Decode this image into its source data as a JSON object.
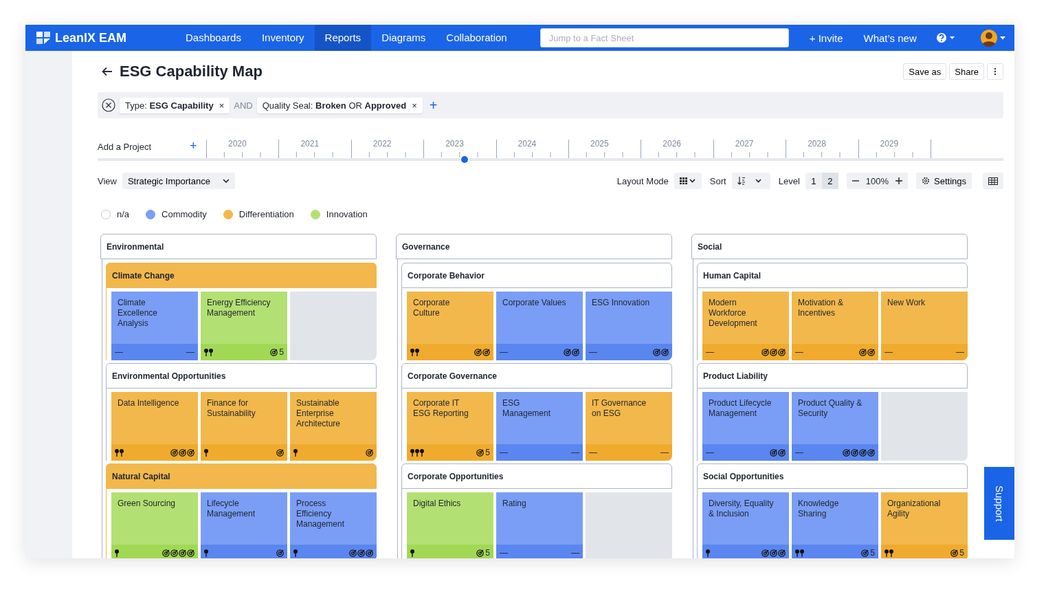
{
  "nav": {
    "logo": "LeanIX EAM",
    "items": [
      {
        "label": "Dashboards",
        "selected": false
      },
      {
        "label": "Inventory",
        "selected": false
      },
      {
        "label": "Reports",
        "selected": true
      },
      {
        "label": "Diagrams",
        "selected": false
      },
      {
        "label": "Collaboration",
        "selected": false
      }
    ],
    "search": {
      "placeholder": "Jump to a Fact Sheet"
    },
    "invite": "+ Invite",
    "whats_new": "What’s new"
  },
  "page": {
    "title": "ESG Capability Map",
    "actions": [
      "Save as",
      "Share"
    ]
  },
  "filters": {
    "chips": [
      {
        "text": "Type: **ESG Capability**",
        "remove": "×"
      },
      {
        "text": "Quality Seal: **Broken** OR **Approved**",
        "remove": "×"
      }
    ],
    "joiner": "AND",
    "add": "+"
  },
  "timeline": {
    "label": "Add a Project",
    "add": "+",
    "years": [
      "2020",
      "2021",
      "2022",
      "2023",
      "2024",
      "2025",
      "2026",
      "2027",
      "2028",
      "2029"
    ],
    "level": 0.405
  },
  "toolbar": {
    "view_label": "View",
    "view_value": "Strategic Importance",
    "layout_label": "Layout Mode",
    "sort_label": "Sort",
    "level_label": "Level",
    "levels": [
      {
        "label": "1",
        "selected": false
      },
      {
        "label": "2",
        "selected": true
      }
    ],
    "zoom": "100%",
    "settings": "Settings"
  },
  "legend": [
    {
      "label": "n/a",
      "kind": "none"
    },
    {
      "label": "Commodity",
      "kind": "commodity",
      "color": "#7b9ef6"
    },
    {
      "label": "Differentiation",
      "kind": "differentiation",
      "color": "#f2b84b"
    },
    {
      "label": "Innovation",
      "kind": "innovation",
      "color": "#b3e072"
    }
  ],
  "groups": [
    {
      "title": "Environmental",
      "children": [
        {
          "title": "Climate Change",
          "kind": "differentiation",
          "cards": [
            {
              "name": "Climate Excellence Analysis",
              "kind": "commodity",
              "left": {
                "text": "—"
              },
              "right": {
                "text": "—"
              }
            },
            {
              "name": "Energy Efficiency Management",
              "kind": "innovation",
              "left": {
                "icons": [
                  {
                    "kind": "pin"
                  },
                  {
                    "kind": "pin"
                  }
                ]
              },
              "right": {
                "icons": [
                  {
                    "kind": "target"
                  }
                ],
                "text": "5"
              }
            },
            {
              "kind": "empty"
            }
          ]
        },
        {
          "title": "Environmental Opportunities",
          "kind": "none",
          "cards": [
            {
              "name": "Data Intelligence",
              "kind": "differentiation",
              "left": {
                "icons": [
                  {
                    "kind": "pin"
                  },
                  {
                    "kind": "pin"
                  }
                ]
              },
              "right": {
                "icons": [
                  {
                    "kind": "target"
                  },
                  {
                    "kind": "target"
                  },
                  {
                    "kind": "target"
                  }
                ]
              }
            },
            {
              "name": "Finance for Sustainability",
              "kind": "differentiation",
              "left": {
                "icons": [
                  {
                    "kind": "pin"
                  }
                ]
              },
              "right": {
                "icons": [
                  {
                    "kind": "target"
                  }
                ]
              }
            },
            {
              "name": "Sustainable Enterprise Architecture",
              "kind": "differentiation",
              "left": {
                "icons": [
                  {
                    "kind": "pin"
                  }
                ]
              },
              "right": {
                "icons": [
                  {
                    "kind": "target"
                  }
                ]
              }
            }
          ]
        },
        {
          "title": "Natural Capital",
          "kind": "differentiation",
          "cards": [
            {
              "name": "Green Sourcing",
              "kind": "innovation",
              "left": {
                "icons": [
                  {
                    "kind": "pin"
                  }
                ]
              },
              "right": {
                "icons": [
                  {
                    "kind": "target"
                  },
                  {
                    "kind": "target"
                  },
                  {
                    "kind": "target"
                  },
                  {
                    "kind": "target"
                  }
                ]
              }
            },
            {
              "name": "Lifecycle Management",
              "kind": "commodity",
              "left": {
                "icons": [
                  {
                    "kind": "pin"
                  }
                ]
              },
              "right": {
                "icons": [
                  {
                    "kind": "target"
                  }
                ]
              }
            },
            {
              "name": "Process Efficiency Management",
              "kind": "commodity",
              "left": {
                "icons": [
                  {
                    "kind": "pin"
                  }
                ]
              },
              "right": {
                "icons": [
                  {
                    "kind": "target"
                  },
                  {
                    "kind": "target"
                  },
                  {
                    "kind": "target"
                  }
                ]
              }
            }
          ]
        }
      ]
    },
    {
      "title": "Governance",
      "children": [
        {
          "title": "Corporate Behavior",
          "kind": "none",
          "cards": [
            {
              "name": "Corporate Culture",
              "kind": "differentiation",
              "left": {
                "icons": [
                  {
                    "kind": "pin"
                  },
                  {
                    "kind": "pin"
                  }
                ]
              },
              "right": {
                "icons": [
                  {
                    "kind": "target"
                  },
                  {
                    "kind": "target"
                  }
                ]
              }
            },
            {
              "name": "Corporate Values",
              "kind": "commodity",
              "left": {
                "text": "—"
              },
              "right": {
                "icons": [
                  {
                    "kind": "target"
                  },
                  {
                    "kind": "target"
                  }
                ]
              }
            },
            {
              "name": "ESG Innovation",
              "kind": "commodity",
              "left": {
                "text": "—"
              },
              "right": {
                "icons": [
                  {
                    "kind": "target"
                  },
                  {
                    "kind": "target"
                  }
                ]
              }
            }
          ]
        },
        {
          "title": "Corporate Governance",
          "kind": "none",
          "cards": [
            {
              "name": "Corporate IT ESG Reporting",
              "kind": "differentiation",
              "left": {
                "icons": [
                  {
                    "kind": "pin"
                  },
                  {
                    "kind": "pin"
                  },
                  {
                    "kind": "pin"
                  }
                ]
              },
              "right": {
                "icons": [
                  {
                    "kind": "target"
                  }
                ],
                "text": "5"
              }
            },
            {
              "name": "ESG Management",
              "kind": "commodity",
              "left": {
                "text": "—"
              },
              "right": {
                "text": "—"
              }
            },
            {
              "name": "IT Governance on ESG",
              "kind": "differentiation",
              "left": {
                "text": "—"
              },
              "right": {
                "text": "—"
              }
            }
          ]
        },
        {
          "title": "Corporate Opportunities",
          "kind": "none",
          "cards": [
            {
              "name": "Digital Ethics",
              "kind": "innovation",
              "left": {
                "icons": [
                  {
                    "kind": "pin"
                  }
                ]
              },
              "right": {
                "icons": [
                  {
                    "kind": "target"
                  }
                ],
                "text": "5"
              }
            },
            {
              "name": "Rating",
              "kind": "commodity",
              "left": {
                "text": "—"
              },
              "right": {
                "text": "—"
              }
            },
            {
              "kind": "empty"
            }
          ]
        }
      ]
    },
    {
      "title": "Social",
      "children": [
        {
          "title": "Human Capital",
          "kind": "none",
          "cards": [
            {
              "name": "Modern Workforce Development",
              "kind": "differentiation",
              "left": {
                "text": "—"
              },
              "right": {
                "icons": [
                  {
                    "kind": "target"
                  },
                  {
                    "kind": "target"
                  },
                  {
                    "kind": "target"
                  }
                ]
              }
            },
            {
              "name": "Motivation & Incentives",
              "kind": "differentiation",
              "left": {
                "text": "—"
              },
              "right": {
                "icons": [
                  {
                    "kind": "target"
                  },
                  {
                    "kind": "target"
                  }
                ]
              }
            },
            {
              "name": "New Work",
              "kind": "differentiation",
              "left": {
                "text": "—"
              },
              "right": {
                "text": "—"
              }
            }
          ]
        },
        {
          "title": "Product Liability",
          "kind": "none",
          "cards": [
            {
              "name": "Product Lifecycle Management",
              "kind": "commodity",
              "left": {
                "text": "—"
              },
              "right": {
                "icons": [
                  {
                    "kind": "target"
                  },
                  {
                    "kind": "target"
                  }
                ]
              }
            },
            {
              "name": "Product Quality & Security",
              "kind": "commodity",
              "left": {
                "text": "—"
              },
              "right": {
                "icons": [
                  {
                    "kind": "target"
                  },
                  {
                    "kind": "target"
                  },
                  {
                    "kind": "target"
                  },
                  {
                    "kind": "target"
                  }
                ]
              }
            },
            {
              "kind": "empty"
            }
          ]
        },
        {
          "title": "Social Opportunities",
          "kind": "none",
          "cards": [
            {
              "name": "Diversity, Equality & Inclusion",
              "kind": "commodity",
              "left": {
                "icons": [
                  {
                    "kind": "pin"
                  }
                ]
              },
              "right": {
                "icons": [
                  {
                    "kind": "target"
                  },
                  {
                    "kind": "target"
                  },
                  {
                    "kind": "target"
                  }
                ]
              }
            },
            {
              "name": "Knowledge Sharing",
              "kind": "commodity",
              "left": {
                "icons": [
                  {
                    "kind": "pin"
                  },
                  {
                    "kind": "pin"
                  }
                ]
              },
              "right": {
                "icons": [
                  {
                    "kind": "target"
                  }
                ],
                "text": "5"
              }
            },
            {
              "name": "Organizational Agility",
              "kind": "differentiation",
              "left": {
                "icons": [
                  {
                    "kind": "pin"
                  },
                  {
                    "kind": "pin"
                  }
                ]
              },
              "right": {
                "icons": [
                  {
                    "kind": "target"
                  }
                ],
                "text": "5"
              }
            }
          ]
        }
      ]
    }
  ],
  "support": "Support"
}
